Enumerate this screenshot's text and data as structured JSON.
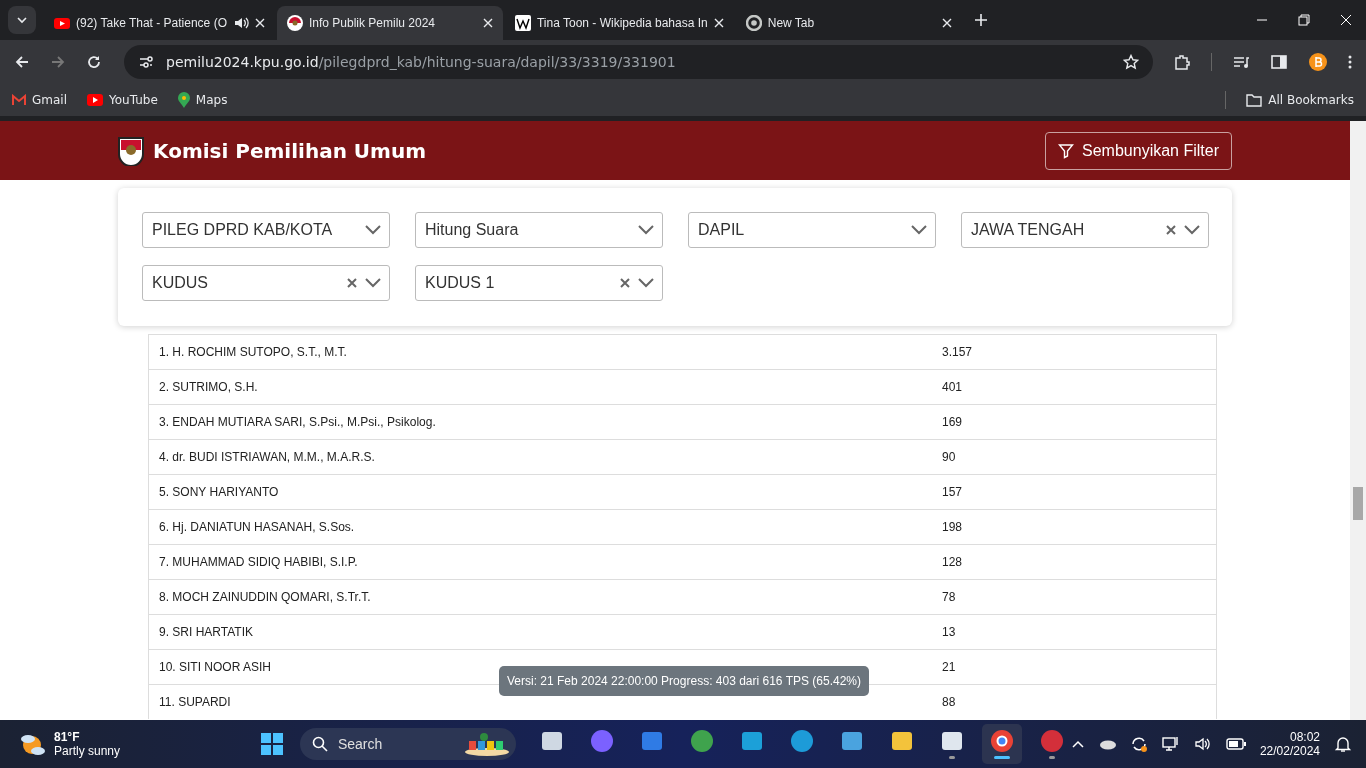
{
  "browser": {
    "tabs": [
      {
        "kind": "youtube",
        "title": "(92) Take That - Patience (O",
        "audio": true,
        "selected": false
      },
      {
        "kind": "kpu",
        "title": "Info Publik Pemilu 2024",
        "audio": false,
        "selected": true
      },
      {
        "kind": "wikipedia",
        "title": "Tina Toon - Wikipedia bahasa In",
        "audio": false,
        "selected": false
      },
      {
        "kind": "chrome",
        "title": "New Tab",
        "audio": false,
        "selected": false
      }
    ],
    "url_host": "pemilu2024.kpu.go.id",
    "url_path": "/pilegdprd_kab/hitung-suara/dapil/33/3319/331901",
    "bookmarks": [
      {
        "kind": "gmail",
        "label": "Gmail"
      },
      {
        "kind": "youtube",
        "label": "YouTube"
      },
      {
        "kind": "maps",
        "label": "Maps"
      }
    ],
    "all_bookmarks": "All Bookmarks"
  },
  "header": {
    "title": "Komisi Pemilihan Umum",
    "filter_button": "Sembunyikan Filter"
  },
  "filters": [
    {
      "value": "PILEG DPRD KAB/KOTA",
      "clearable": false
    },
    {
      "value": "Hitung Suara",
      "clearable": false
    },
    {
      "value": "DAPIL",
      "clearable": false
    },
    {
      "value": "JAWA TENGAH",
      "clearable": true
    },
    {
      "value": "KUDUS",
      "clearable": true
    },
    {
      "value": "KUDUS 1",
      "clearable": true
    }
  ],
  "rows": [
    {
      "name": "1. H. ROCHIM SUTOPO, S.T., M.T.",
      "votes": "3.157"
    },
    {
      "name": "2. SUTRIMO, S.H.",
      "votes": "401"
    },
    {
      "name": "3. ENDAH MUTIARA SARI, S.Psi., M.Psi., Psikolog.",
      "votes": "169"
    },
    {
      "name": "4. dr. BUDI ISTRIAWAN, M.M., M.A.R.S.",
      "votes": "90"
    },
    {
      "name": "5. SONY HARIYANTO",
      "votes": "157"
    },
    {
      "name": "6. Hj. DANIATUN HASANAH, S.Sos.",
      "votes": "198"
    },
    {
      "name": "7. MUHAMMAD SIDIQ HABIBI, S.I.P.",
      "votes": "128"
    },
    {
      "name": "8. MOCH ZAINUDDIN QOMARI, S.Tr.T.",
      "votes": "78"
    },
    {
      "name": "9. SRI HARTATIK",
      "votes": "13"
    },
    {
      "name": "10. SITI NOOR ASIH",
      "votes": "21"
    },
    {
      "name": "11. SUPARDI",
      "votes": "88"
    }
  ],
  "version_tooltip": "Versi: 21 Feb 2024 22:00:00 Progress: 403 dari 616 TPS (65.42%)",
  "taskbar": {
    "weather_temp": "81°F",
    "weather_desc": "Partly sunny",
    "search_placeholder": "Search",
    "apps": [
      {
        "kind": "taskview",
        "running": false,
        "selected": false
      },
      {
        "kind": "meet",
        "running": false,
        "selected": false
      },
      {
        "kind": "store",
        "running": false,
        "selected": false
      },
      {
        "kind": "idm",
        "running": false,
        "selected": false
      },
      {
        "kind": "lapp",
        "running": false,
        "selected": false
      },
      {
        "kind": "edge",
        "running": false,
        "selected": false
      },
      {
        "kind": "panel",
        "running": false,
        "selected": false
      },
      {
        "kind": "folder",
        "running": false,
        "selected": false
      },
      {
        "kind": "box",
        "running": true,
        "selected": false
      },
      {
        "kind": "chrome",
        "running": true,
        "selected": true
      },
      {
        "kind": "ring",
        "running": true,
        "selected": false
      }
    ],
    "time": "08:02",
    "date": "22/02/2024"
  }
}
